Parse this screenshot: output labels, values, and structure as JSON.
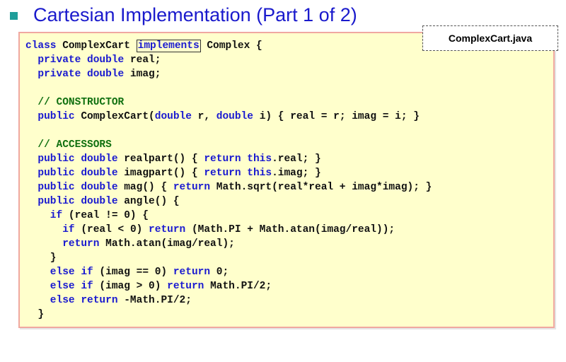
{
  "slide": {
    "title": "Cartesian Implementation (Part 1 of 2)",
    "filename": "ComplexCart.java"
  },
  "code": {
    "lines": [
      [
        [
          "class ",
          "k"
        ],
        [
          "ComplexCart ",
          "t"
        ],
        [
          "implements",
          "kb"
        ],
        [
          " Complex {",
          "t"
        ]
      ],
      [
        [
          "  private double ",
          "k"
        ],
        [
          "real;",
          "t"
        ]
      ],
      [
        [
          "  private double ",
          "k"
        ],
        [
          "imag;",
          "t"
        ]
      ],
      [],
      [
        [
          "  // CONSTRUCTOR",
          "c"
        ]
      ],
      [
        [
          "  public ",
          "k"
        ],
        [
          "ComplexCart(",
          "t"
        ],
        [
          "double ",
          "k"
        ],
        [
          "r, ",
          "t"
        ],
        [
          "double ",
          "k"
        ],
        [
          "i) { real = r; imag = i; }",
          "t"
        ]
      ],
      [],
      [
        [
          "  // ACCESSORS",
          "c"
        ]
      ],
      [
        [
          "  public double ",
          "k"
        ],
        [
          "realpart() { ",
          "t"
        ],
        [
          "return this",
          "k"
        ],
        [
          ".real; }",
          "t"
        ]
      ],
      [
        [
          "  public double ",
          "k"
        ],
        [
          "imagpart() { ",
          "t"
        ],
        [
          "return this",
          "k"
        ],
        [
          ".imag; }",
          "t"
        ]
      ],
      [
        [
          "  public double ",
          "k"
        ],
        [
          "mag() { ",
          "t"
        ],
        [
          "return ",
          "k"
        ],
        [
          "Math.sqrt(real*real + imag*imag); }",
          "t"
        ]
      ],
      [
        [
          "  public double ",
          "k"
        ],
        [
          "angle() {",
          "t"
        ]
      ],
      [
        [
          "    if ",
          "k"
        ],
        [
          "(real != 0) {",
          "t"
        ]
      ],
      [
        [
          "      if ",
          "k"
        ],
        [
          "(real < 0) ",
          "t"
        ],
        [
          "return ",
          "k"
        ],
        [
          "(Math.PI + Math.atan(imag/real));",
          "t"
        ]
      ],
      [
        [
          "      return ",
          "k"
        ],
        [
          "Math.atan(imag/real);",
          "t"
        ]
      ],
      [
        [
          "    }",
          "t"
        ]
      ],
      [
        [
          "    else if ",
          "k"
        ],
        [
          "(imag == 0) ",
          "t"
        ],
        [
          "return ",
          "k"
        ],
        [
          "0;",
          "t"
        ]
      ],
      [
        [
          "    else if ",
          "k"
        ],
        [
          "(imag > 0) ",
          "t"
        ],
        [
          "return ",
          "k"
        ],
        [
          "Math.PI/2;",
          "t"
        ]
      ],
      [
        [
          "    else return ",
          "k"
        ],
        [
          "-Math.PI/2;",
          "t"
        ]
      ],
      [
        [
          "  }",
          "t"
        ]
      ]
    ]
  }
}
